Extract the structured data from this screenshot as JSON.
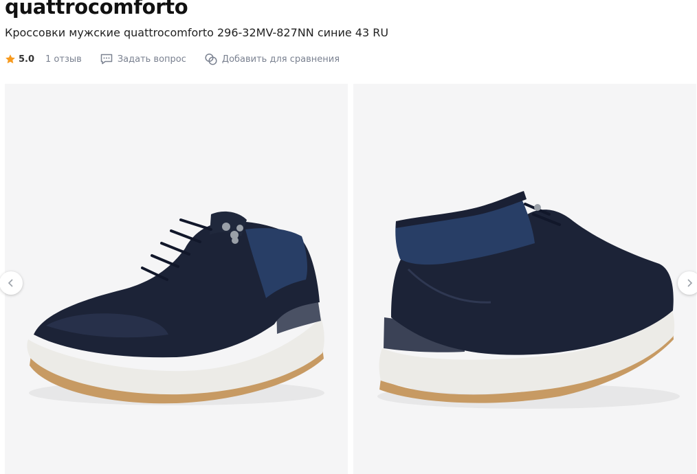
{
  "product": {
    "brand": "quattrocomforto",
    "title": "Кроссовки мужские quattrocomforto 296-32MV-827NN синие 43 RU"
  },
  "rating": {
    "value": "5.0",
    "reviews_label": "1 отзыв",
    "star_color": "#f79a1e"
  },
  "actions": {
    "ask_label": "Задать вопрос",
    "compare_label": "Добавить для сравнения"
  },
  "gallery": {
    "photos": [
      {
        "alt": "Кроссовки мужские quattrocomforto 296-32MV-827NN синие 43 RU — вид спереди сбоку"
      },
      {
        "alt": "Кроссовки мужские quattrocomforto 296-32MV-827NN синие 43 RU — вид сзади сбоку"
      }
    ],
    "prev_icon": "chevron-left-icon",
    "next_icon": "chevron-right-icon"
  },
  "colors": {
    "leather": "#1c2337",
    "mesh": "#283e66",
    "sole": "#ecebe7",
    "outsole": "#c79a63",
    "background": "#f5f5f6"
  }
}
